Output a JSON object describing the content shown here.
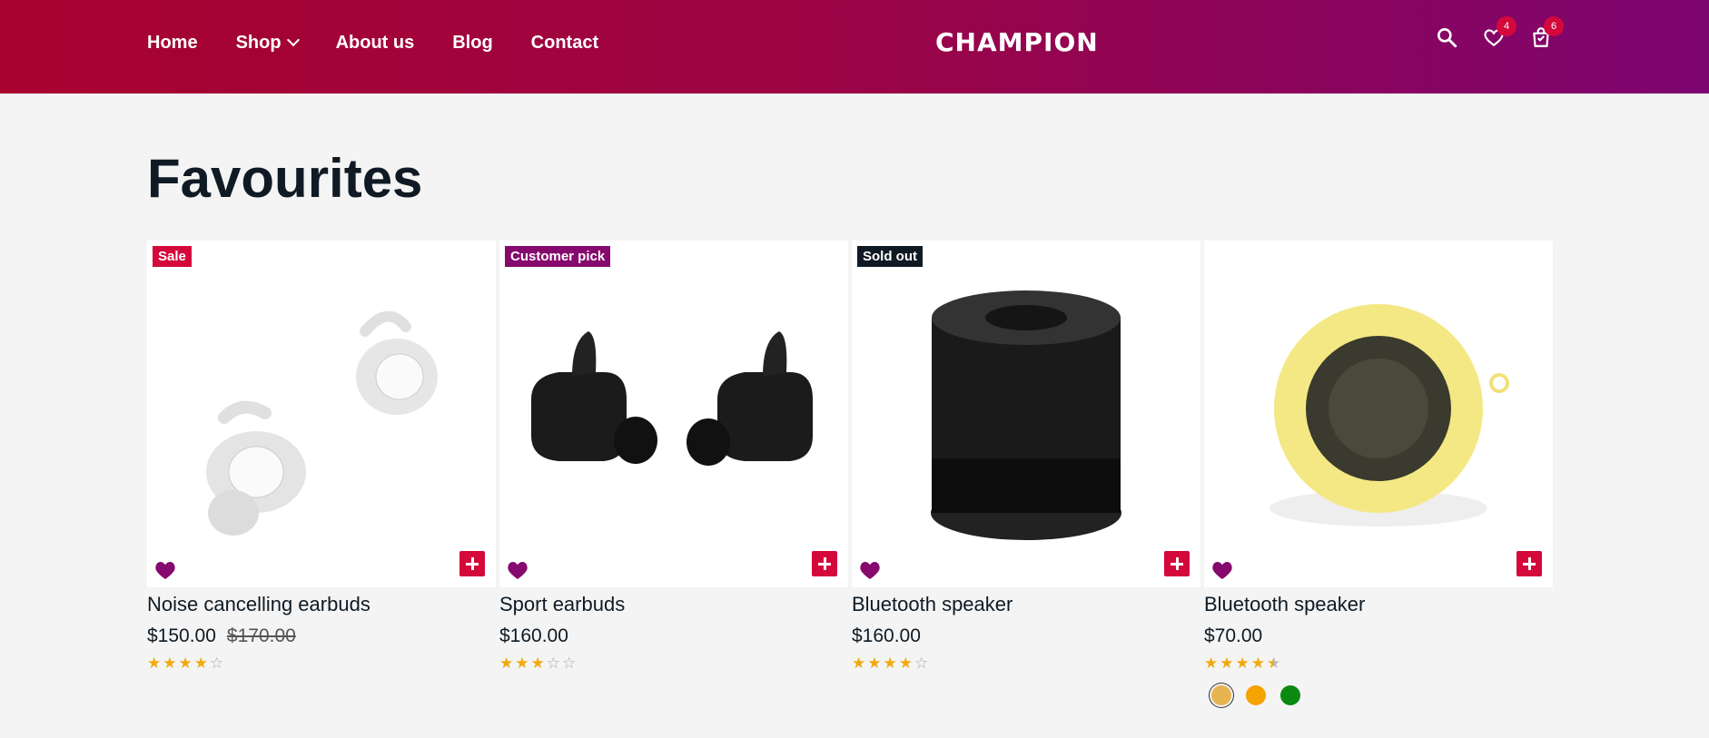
{
  "nav": {
    "items": [
      {
        "label": "Home"
      },
      {
        "label": "Shop"
      },
      {
        "label": "About us"
      },
      {
        "label": "Blog"
      },
      {
        "label": "Contact"
      }
    ]
  },
  "logo": {
    "text": "CHAMPION"
  },
  "header": {
    "wishlist_count": "4",
    "cart_count": "6"
  },
  "page": {
    "title": "Favourites"
  },
  "products": [
    {
      "tag": "Sale",
      "name": "Noise cancelling earbuds",
      "price": "$150.00",
      "old_price": "$170.00",
      "rating": 4,
      "rating_max": 5
    },
    {
      "tag": "Customer pick",
      "name": "Sport earbuds",
      "price": "$160.00",
      "old_price": "",
      "rating": 3,
      "rating_max": 5
    },
    {
      "tag": "Sold out",
      "name": "Bluetooth speaker",
      "price": "$160.00",
      "old_price": "",
      "rating": 4,
      "rating_max": 5
    },
    {
      "tag": "",
      "name": "Bluetooth speaker",
      "price": "$70.00",
      "old_price": "",
      "rating": 4.5,
      "rating_max": 5,
      "swatches": [
        "#e6b450",
        "#f5a300",
        "#0b8a12"
      ]
    }
  ],
  "colors": {
    "accent": "#d4083b",
    "purple": "#86096d",
    "star": "#f2a90f"
  }
}
